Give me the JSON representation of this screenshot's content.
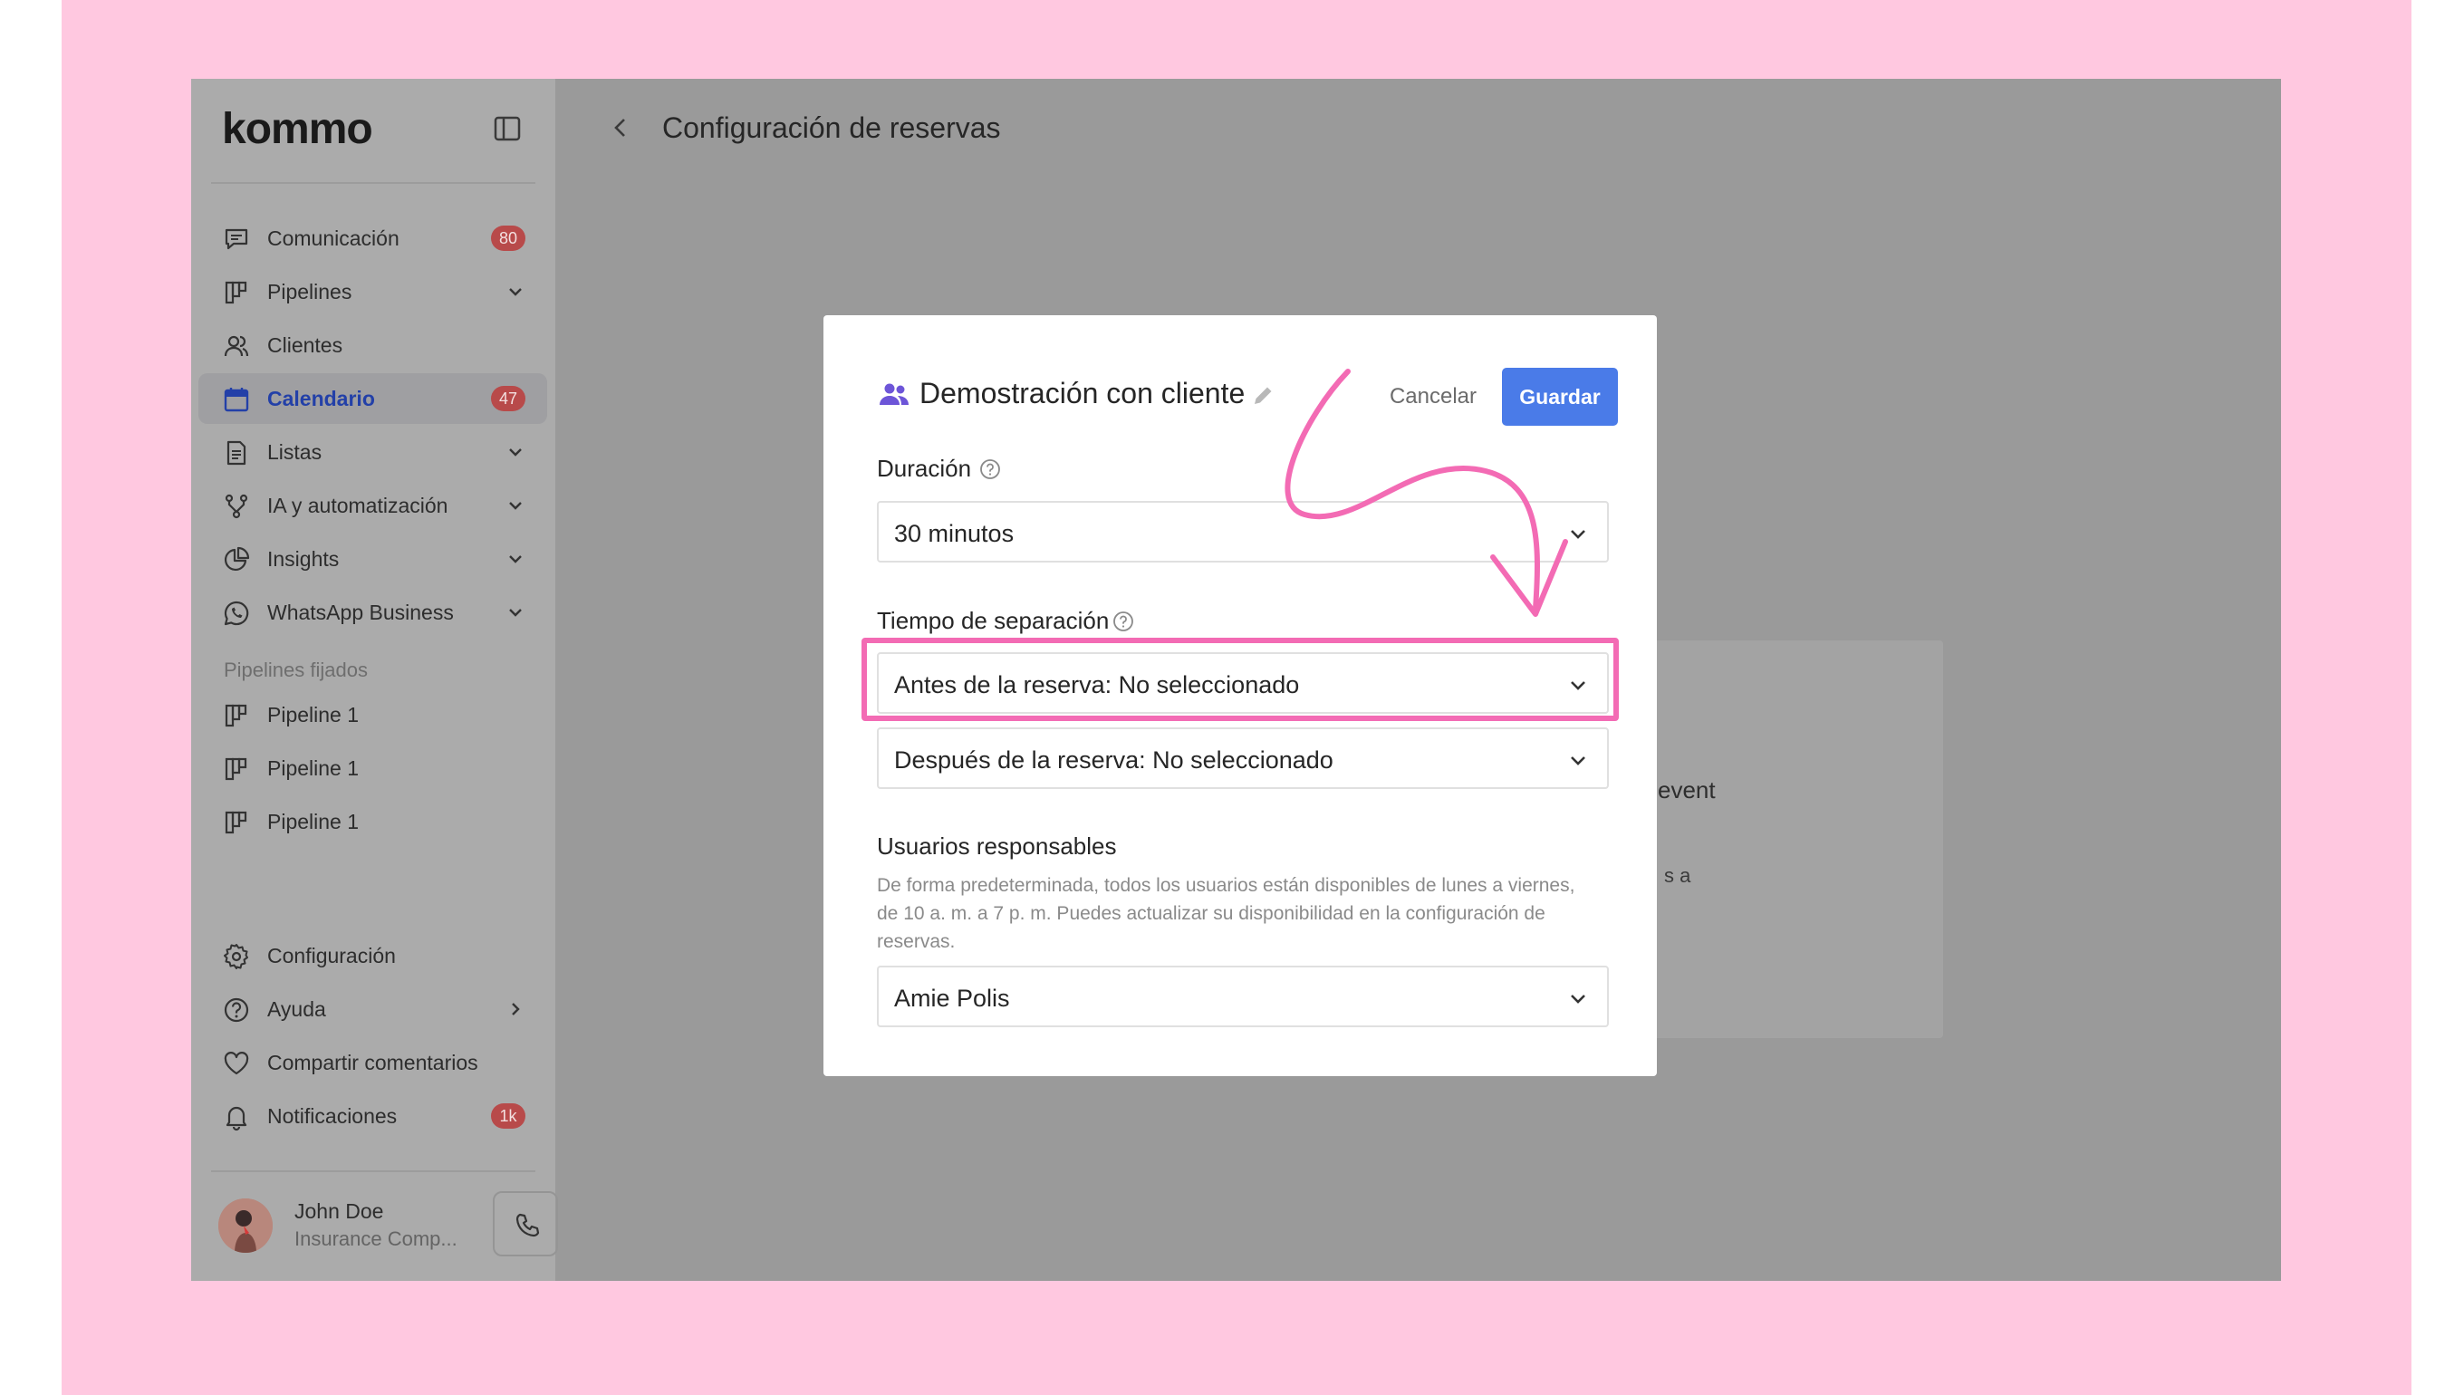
{
  "app": {
    "logo": "kommo"
  },
  "sidebar": {
    "items": [
      {
        "label": "Comunicación",
        "icon": "chat-icon",
        "badge": "80"
      },
      {
        "label": "Pipelines",
        "icon": "pipeline-icon",
        "expandable": true
      },
      {
        "label": "Clientes",
        "icon": "users-icon"
      },
      {
        "label": "Calendario",
        "icon": "calendar-icon",
        "badge": "47",
        "active": true
      },
      {
        "label": "Listas",
        "icon": "list-icon",
        "expandable": true
      },
      {
        "label": "IA y automatización",
        "icon": "automation-icon",
        "expandable": true
      },
      {
        "label": "Insights",
        "icon": "chart-pie-icon",
        "expandable": true
      },
      {
        "label": "WhatsApp Business",
        "icon": "whatsapp-icon",
        "expandable": true
      }
    ],
    "pinned_section_label": "Pipelines fijados",
    "pinned": [
      {
        "label": "Pipeline 1"
      },
      {
        "label": "Pipeline 1"
      },
      {
        "label": "Pipeline 1"
      }
    ],
    "bottom_items": [
      {
        "label": "Configuración",
        "icon": "gear-icon"
      },
      {
        "label": "Ayuda",
        "icon": "help-icon"
      },
      {
        "label": "Compartir comentarios",
        "icon": "heart-icon"
      },
      {
        "label": "Notificaciones",
        "icon": "bell-icon",
        "badge": "1k"
      }
    ],
    "user": {
      "name": "John Doe",
      "company": "Insurance Comp..."
    }
  },
  "header": {
    "title": "Configuración de reservas"
  },
  "background_card": {
    "text1": "event",
    "text2": "s a"
  },
  "modal": {
    "title": "Demostración con cliente",
    "cancel_label": "Cancelar",
    "save_label": "Guardar",
    "duration": {
      "label": "Duración",
      "value": "30 minutos"
    },
    "buffer": {
      "label": "Tiempo de separación",
      "before_value": "Antes de la reserva: No seleccionado",
      "after_value": "Después de la reserva: No seleccionado"
    },
    "responsible": {
      "label": "Usuarios responsables",
      "helper": "De forma predeterminada, todos los usuarios están disponibles de lunes a viernes, de 10 a. m. a 7 p. m. Puedes actualizar su disponibilidad en la configuración de reservas.",
      "value": "Amie Polis"
    }
  },
  "colors": {
    "accent": "#4a7be8",
    "highlight": "#f36bb4",
    "badge": "#b84a4a",
    "active_nav": "#2340a8",
    "page_background": "#ffc8e0"
  }
}
